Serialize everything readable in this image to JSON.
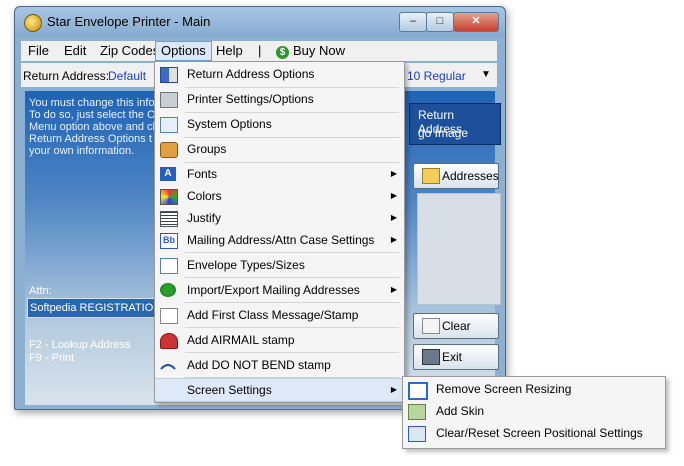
{
  "window": {
    "title": "Star Envelope Printer - Main",
    "caption_min": "–",
    "caption_max": "□",
    "caption_close": "✕"
  },
  "menubar": {
    "file": "File",
    "edit": "Edit",
    "zip_codes": "Zip Codes",
    "options": "Options",
    "help": "Help",
    "separator": "|",
    "buy_now": "Buy Now",
    "buy_icon": "dollar-icon"
  },
  "address_bar": {
    "label": "Return Address:",
    "value": "Default",
    "font_value": "10 Regular",
    "dropdown_glyph": "▼"
  },
  "workarea": {
    "info_lines": [
      "You must change this info",
      "To do so, just select the O",
      "Menu option above and cl",
      "Return Address Options t",
      "your own information."
    ],
    "attn_label": "Attn:",
    "attn_value": "Softpedia REGISTRATION",
    "hint_lookup": "F2 - Lookup Address",
    "hint_print": "F9 - Print",
    "return_address_opt": "Return Address",
    "logo_image_opt": "go Image",
    "addresses_button": "Addresses",
    "clear_button": "Clear",
    "exit_button": "Exit"
  },
  "options_menu": {
    "items": [
      {
        "label": "Return Address Options",
        "icon": "return-address-icon"
      },
      {
        "label": "Printer Settings/Options",
        "icon": "printer-icon"
      },
      {
        "label": "System Options",
        "icon": "system-icon"
      },
      {
        "label": "Groups",
        "icon": "groups-icon"
      },
      {
        "label": "Fonts",
        "icon": "fonts-icon",
        "submenu": true
      },
      {
        "label": "Colors",
        "icon": "colors-icon",
        "submenu": true
      },
      {
        "label": "Justify",
        "icon": "justify-icon",
        "submenu": true
      },
      {
        "label": "Mailing Address/Attn Case Settings",
        "icon": "case-icon",
        "submenu": true
      },
      {
        "label": "Envelope Types/Sizes",
        "icon": "envelope-icon"
      },
      {
        "label": "Import/Export Mailing Addresses",
        "icon": "import-export-icon",
        "submenu": true
      },
      {
        "label": "Add First Class Message/Stamp",
        "icon": "first-class-icon"
      },
      {
        "label": "Add AIRMAIL stamp",
        "icon": "airmail-icon"
      },
      {
        "label": "Add DO NOT BEND stamp",
        "icon": "do-not-bend-icon"
      },
      {
        "label": "Screen Settings",
        "icon": "",
        "submenu": true
      }
    ],
    "submenu_arrow": "▶"
  },
  "screen_settings_submenu": {
    "items": [
      {
        "label": "Remove Screen Resizing",
        "icon": "resize-icon"
      },
      {
        "label": "Add Skin",
        "icon": "skin-icon"
      },
      {
        "label": "Clear/Reset Screen Positional Settings",
        "icon": "reset-icon"
      }
    ]
  }
}
